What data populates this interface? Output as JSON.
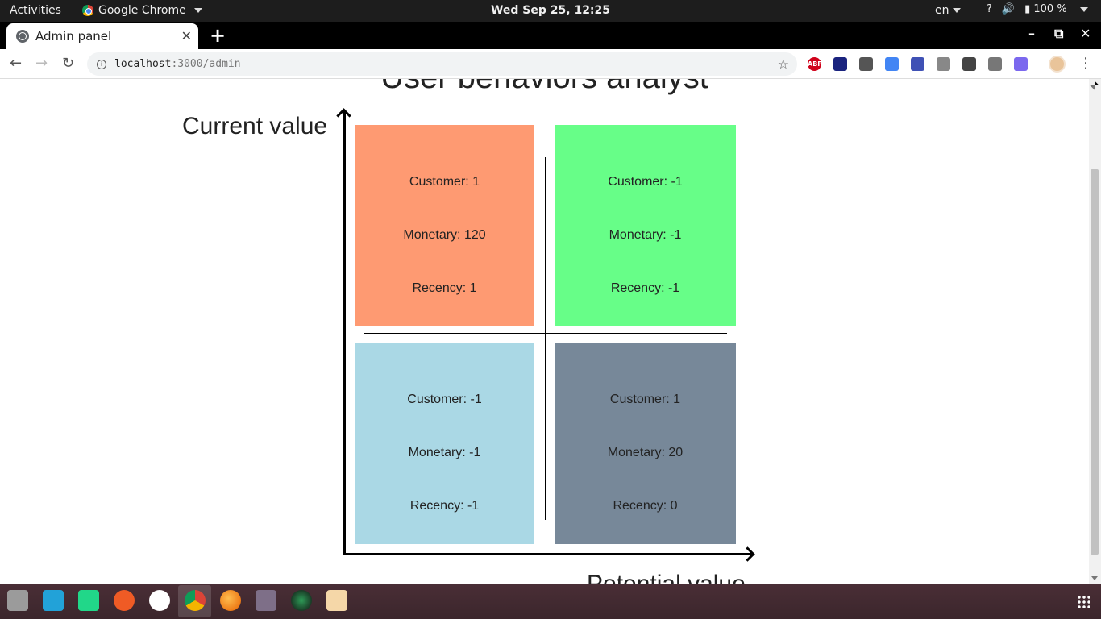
{
  "system_bar": {
    "activities": "Activities",
    "app_name": "Google Chrome",
    "clock": "Wed Sep 25, 12:25",
    "language": "en",
    "battery": "100 %"
  },
  "browser": {
    "tab_title": "Admin panel",
    "url_host": "localhost",
    "url_rest": ":3000/admin",
    "extensions": [
      "ABP"
    ]
  },
  "page": {
    "title": "User behaviors analyst",
    "y_axis_label": "Current value",
    "x_axis_label": "Potential value",
    "quadrants": {
      "top_left": {
        "color": "#fe9a72",
        "customer": "Customer: 1",
        "monetary": "Monetary: 120",
        "recency": "Recency: 1"
      },
      "top_right": {
        "color": "#67fe88",
        "customer": "Customer: -1",
        "monetary": "Monetary: -1",
        "recency": "Recency: -1"
      },
      "bottom_left": {
        "color": "#aad8e5",
        "customer": "Customer: -1",
        "monetary": "Monetary: -1",
        "recency": "Recency: -1"
      },
      "bottom_right": {
        "color": "#778899",
        "customer": "Customer: 1",
        "monetary": "Monetary: 20",
        "recency": "Recency: 0"
      }
    }
  },
  "dock": {
    "apps": [
      "files-icon",
      "vscode-icon",
      "pycharm-icon",
      "postman-icon",
      "mongodb-compass-icon",
      "chrome-icon",
      "firefox-icon",
      "video-player-icon",
      "screenshot-icon",
      "text-editor-icon"
    ]
  }
}
